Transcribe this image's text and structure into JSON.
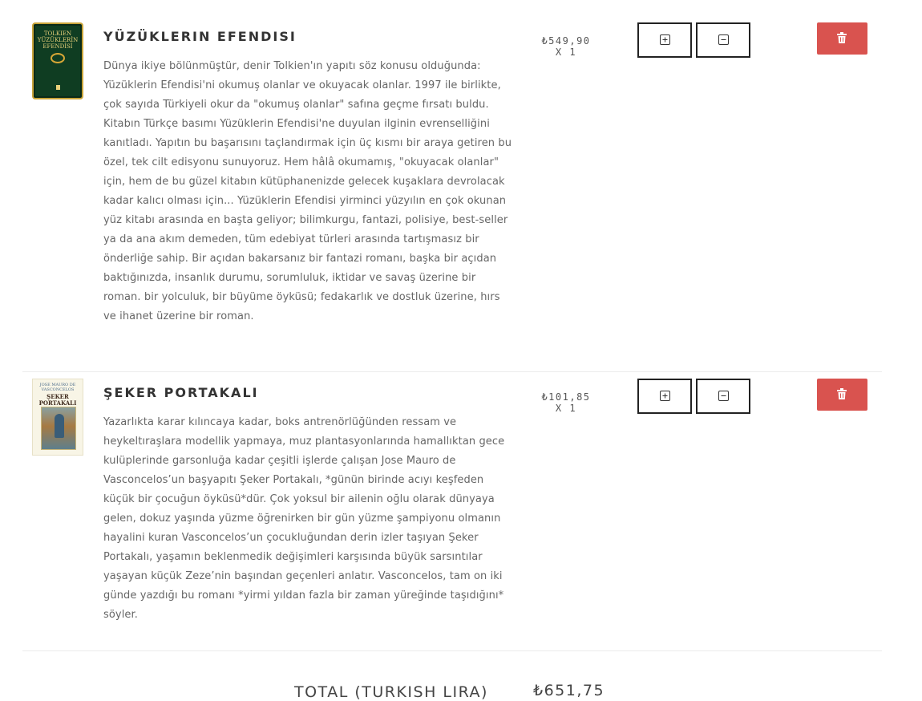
{
  "items": [
    {
      "title": "YÜZÜKLERIN EFENDISI",
      "cover_text_author": "TOLKIEN",
      "cover_text_title": "YÜZÜKLERİN EFENDİSİ",
      "description": "Dünya ikiye bölünmüştür, denir Tolkien'ın yapıtı söz konusu olduğunda: Yüzüklerin Efendisi'ni okumuş olanlar ve okuyacak olanlar. 1997 ile birlikte, çok sayıda Türkiyeli okur da \"okumuş olanlar\" safına geçme fırsatı buldu. Kitabın Türkçe basımı Yüzüklerin Efendisi'ne duyulan ilginin evrenselliğini kanıtladı. Yapıtın bu başarısını taçlandırmak için üç kısmı bir araya getiren bu özel, tek cilt edisyonu sunuyoruz. Hem hâlâ okumamış, \"okuyacak olanlar\" için, hem de bu güzel kitabın kütüphanenizde gelecek kuşaklara devrolacak kadar kalıcı olması için... Yüzüklerin Efendisi yirminci yüzyılın en çok okunan yüz kitabı arasında en başta geliyor; bilimkurgu, fantazi, polisiye, best-seller ya da ana akım demeden, tüm edebiyat türleri arasında tartışmasız bir önderliğe sahip. Bir açıdan bakarsanız bir fantazi romanı, başka bir açıdan baktığınızda, insanlık durumu, sorumluluk, iktidar ve savaş üzerine bir roman. bir yolculuk, bir büyüme öyküsü; fedakarlık ve dostluk üzerine, hırs ve ihanet üzerine bir roman.",
      "price": "₺549,90",
      "quantity": "X 1"
    },
    {
      "title": "ŞEKER PORTAKALI",
      "cover_text_author": "JOSE MAURO DE VASCONCELOS",
      "cover_text_title": "ŞEKER PORTAKALI",
      "description": "Yazarlıkta karar kılıncaya kadar, boks antrenörlüğünden ressam ve heykeltıraşlara modellik yapmaya, muz plantasyonlarında hamallıktan gece kulüplerinde garsonluğa kadar çeşitli işlerde çalışan Jose Mauro de Vasconcelos’un başyapıtı Şeker Portakalı, *günün birinde acıyı keşfeden küçük bir çocuğun öyküsü*dür. Çok yoksul bir ailenin oğlu olarak dünyaya gelen, dokuz yaşında yüzme öğrenirken bir gün yüzme şampiyonu olmanın hayalini kuran Vasconcelos’un çocukluğundan derin izler taşıyan Şeker Portakalı, yaşamın beklenmedik değişimleri karşısında büyük sarsıntılar yaşayan küçük Zeze’nin başından geçenleri anlatır. Vasconcelos, tam on iki günde yazdığı bu romanı *yirmi yıldan fazla bir zaman yüreğinde taşıdığını* söyler.",
      "price": "₺101,85",
      "quantity": "X 1"
    }
  ],
  "total": {
    "label": "TOTAL (TURKISH LIRA)",
    "value": "₺651,75"
  },
  "icons": {
    "increase": "plus-square-icon",
    "decrease": "minus-square-icon",
    "delete": "trash-icon"
  },
  "colors": {
    "delete_button": "#d9534f",
    "button_border": "#222222",
    "text": "#666666"
  }
}
